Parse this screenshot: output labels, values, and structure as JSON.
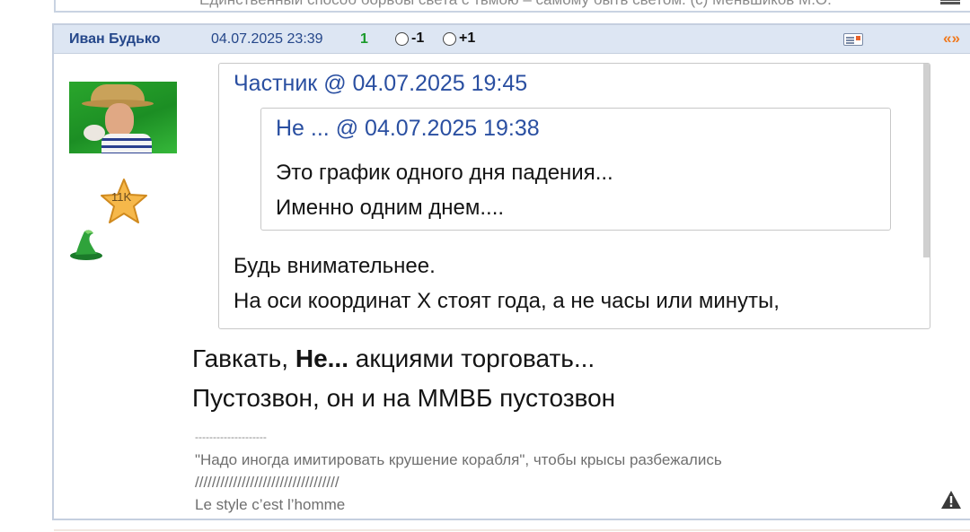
{
  "previous_post": {
    "text": "Единственный способ борьбы света с тьмою – самому быть светом. (с) Меньшиков М.О."
  },
  "post": {
    "author": "Иван Будько",
    "date": "04.07.2025 23:39",
    "rating": "1",
    "vote_minus": "-1",
    "vote_plus": "+1",
    "quote_link": "«»",
    "rank_badge": "11K",
    "icons": {
      "message": "envelope-icon",
      "report": "warning-icon",
      "rank": "star-icon",
      "status": "wizard-hat-icon"
    },
    "colors": {
      "author": "#25478a",
      "rating": "#1a9a2a",
      "quote_link": "#f07a1f",
      "header_bg": "#dde6f3"
    }
  },
  "quote": {
    "author": "Частник",
    "at": "@",
    "date": "04.07.2025 19:45",
    "nested": {
      "author": "Не ...",
      "at": "@",
      "date": "04.07.2025 19:38",
      "lines": [
        "Это график одного дня падения...",
        "Именно одним днем...."
      ]
    },
    "lines": [
      "Будь внимательнее.",
      "На оси координат Х стоят года, а не часы или минуты,"
    ]
  },
  "reply": {
    "line1_before": "Гавкать, ",
    "line1_bold": "Не...",
    "line1_after": " акциями торговать...",
    "line2": "Пустозвон, он и на ММВБ пустозвон"
  },
  "signature": {
    "dashes": "--------------------",
    "quote": "\"Надо иногда имитировать крушение корабля\", чтобы крысы разбежались",
    "slashes": "//////////////////////////////////",
    "motto": "Le style c’est l’homme"
  }
}
